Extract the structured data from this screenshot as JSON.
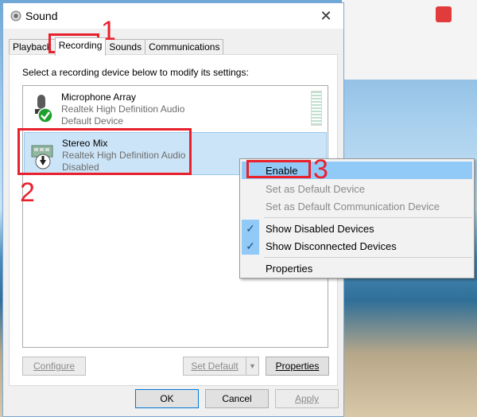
{
  "window": {
    "title": "Sound",
    "close_symbol": "✕"
  },
  "tabs": [
    "Playback",
    "Recording",
    "Sounds",
    "Communications"
  ],
  "active_tab": "Recording",
  "instruction": "Select a recording device below to modify its settings:",
  "devices": [
    {
      "name": "Microphone Array",
      "driver": "Realtek High Definition Audio",
      "status": "Default Device",
      "icon": "microphone-icon",
      "badge": "green-check-icon"
    },
    {
      "name": "Stereo Mix",
      "driver": "Realtek High Definition Audio",
      "status": "Disabled",
      "icon": "sound-card-icon",
      "badge": "down-arrow-icon",
      "selected": true
    }
  ],
  "panel_buttons": {
    "configure": "Configure",
    "set_default": "Set Default",
    "properties": "Properties"
  },
  "dialog_buttons": {
    "ok": "OK",
    "cancel": "Cancel",
    "apply": "Apply"
  },
  "context_menu": {
    "items": [
      {
        "label": "Enable",
        "highlighted": true
      },
      {
        "label": "Set as Default Device",
        "disabled": true
      },
      {
        "label": "Set as Default Communication Device",
        "disabled": true
      },
      {
        "label": "Show Disabled Devices",
        "checked": true
      },
      {
        "label": "Show Disconnected Devices",
        "checked": true
      },
      {
        "label": "Properties"
      }
    ]
  },
  "annotations": [
    "1",
    "2",
    "3"
  ],
  "colors": {
    "annotation": "#e8212d",
    "selection": "#cce4f7",
    "menu_highlight": "#91c9f7",
    "default_badge": "#1fa02e"
  }
}
